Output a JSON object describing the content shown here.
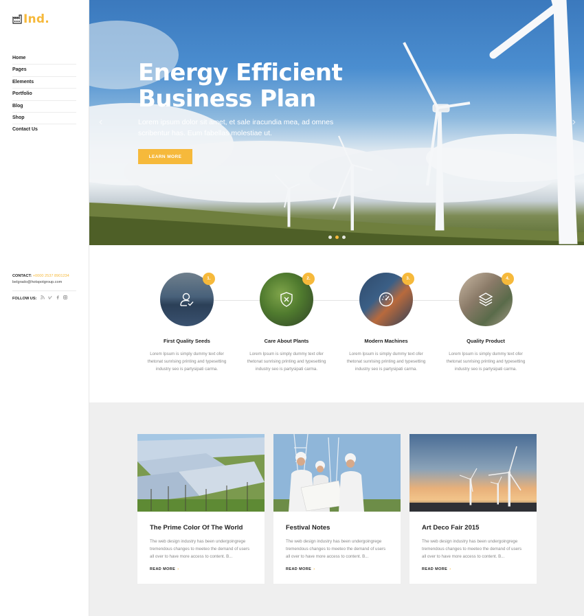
{
  "brand": {
    "logo_text": "Ind.",
    "accent": "#f6b93b"
  },
  "nav": {
    "items": [
      "Home",
      "Pages",
      "Elements",
      "Portfolio",
      "Blog",
      "Shop",
      "Contact Us"
    ]
  },
  "contact": {
    "label": "CONTACT:",
    "phone": "+0000 2537 8901234",
    "email": "belgrado@hotspotgroup.com",
    "follow_label": "FOLLOW US:",
    "social_icons": [
      "rss-icon",
      "vimeo-icon",
      "facebook-icon",
      "instagram-icon"
    ]
  },
  "hero": {
    "title": "Energy Efficient Business Plan",
    "subtitle": "Lorem ipsum dolor sit amet, et sale iracundia mea, ad omnes scribentur has. Eum fabellas molestiae ut.",
    "button_label": "LEARN MORE",
    "arrow_left": "‹",
    "arrow_right": "›",
    "slides": 3,
    "active_slide": 2
  },
  "features": [
    {
      "number": "1.",
      "title": "First Quality Seeds",
      "text": "Lorem Ipsum is simply dummy text ofer thetonat sunrising printing and typesetting industry seo is partysipati carma.",
      "icon": "user-check-icon"
    },
    {
      "number": "2.",
      "title": "Care About Plants",
      "text": "Lorem Ipsum is simply dummy text ofer thetonat sunrising printing and typesetting industry seo is partysipati carma.",
      "icon": "shield-x-icon"
    },
    {
      "number": "3.",
      "title": "Modern Machines",
      "text": "Lorem Ipsum is simply dummy text ofer thetonat sunrising printing and typesetting industry seo is partysipati carma.",
      "icon": "gauge-icon"
    },
    {
      "number": "4.",
      "title": "Quality Product",
      "text": "Lorem Ipsum is simply dummy text ofer thetonat sunrising printing and typesetting industry seo is partysipati carma.",
      "icon": "layers-icon"
    }
  ],
  "posts": [
    {
      "title": "The Prime Color Of The World",
      "text": "The web design industry has been undergoingrege tremendous changes to meeteo the demand of users all over to have more access to content. B...",
      "read_more": "READ MORE",
      "chev": "›"
    },
    {
      "title": "Festival Notes",
      "text": "The web design industry has been undergoingrege tremendous changes to meeteo the demand of users all over to have more access to content. B...",
      "read_more": "READ MORE",
      "chev": "›"
    },
    {
      "title": "Art Deco Fair 2015",
      "text": "The web design industry has been undergoingrege tremendous changes to meeteo the demand of users all over to have more access to content. B...",
      "read_more": "READ MORE",
      "chev": "›"
    }
  ]
}
